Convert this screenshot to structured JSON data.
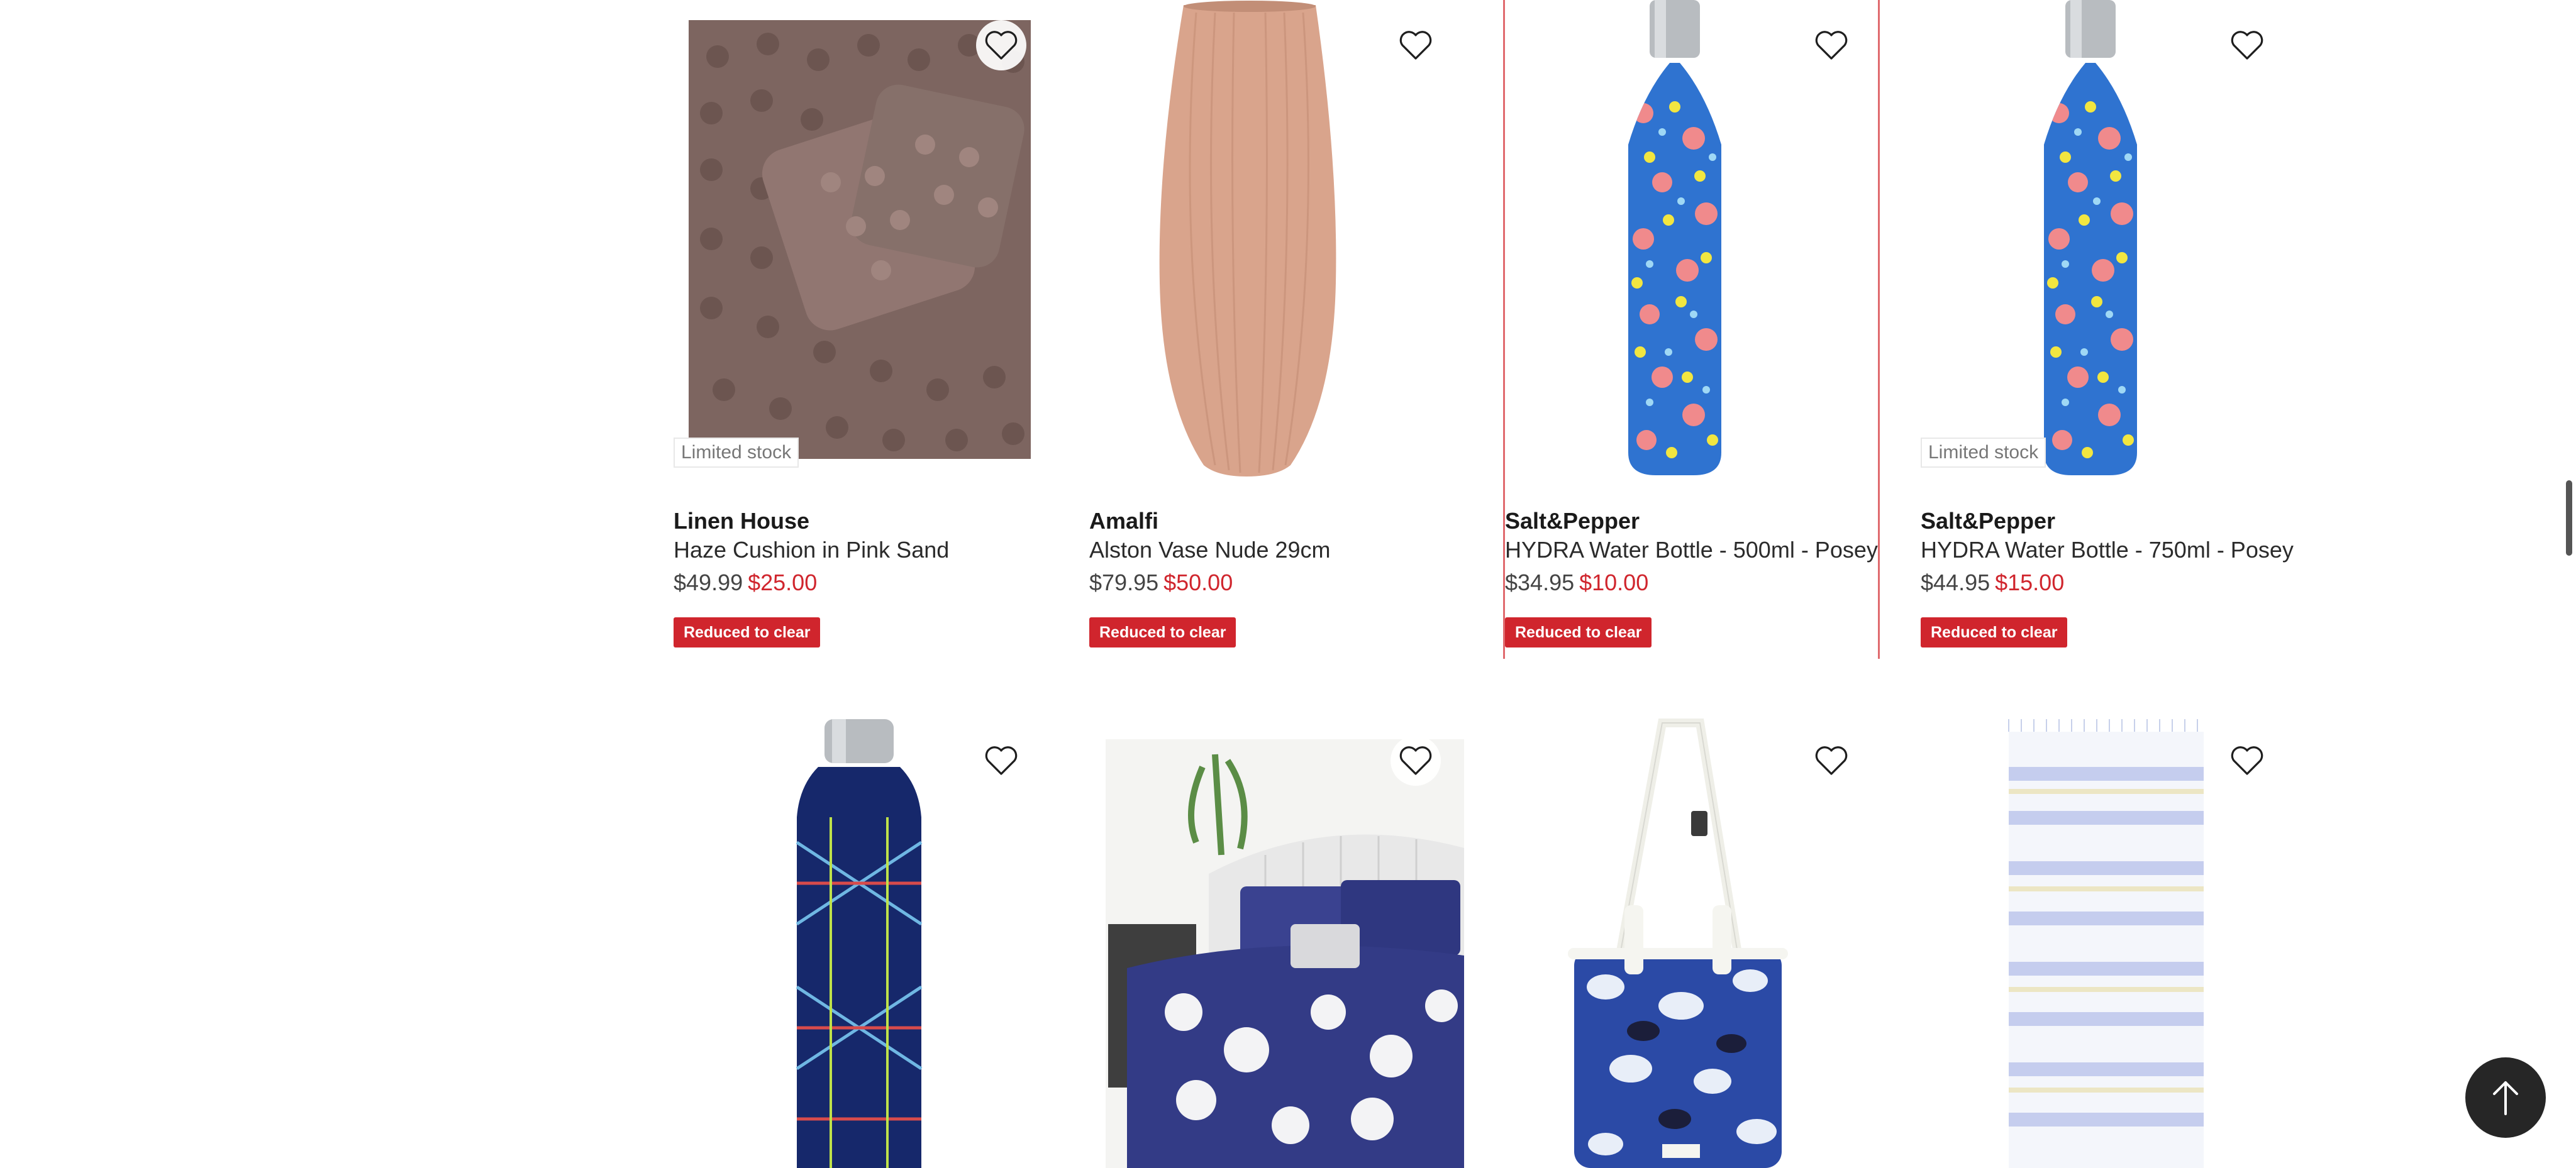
{
  "products": [
    {
      "brand": "Linen House",
      "name": "Haze Cushion in Pink Sand",
      "was": "$49.99",
      "now": "$25.00",
      "badge": "Reduced to clear",
      "limited": "Limited stock"
    },
    {
      "brand": "Amalfi",
      "name": "Alston Vase Nude 29cm",
      "was": "$79.95",
      "now": "$50.00",
      "badge": "Reduced to clear"
    },
    {
      "brand": "Salt&Pepper",
      "name": "HYDRA Water Bottle - 500ml - Posey",
      "was": "$34.95",
      "now": "$10.00",
      "badge": "Reduced to clear"
    },
    {
      "brand": "Salt&Pepper",
      "name": "HYDRA Water Bottle - 750ml - Posey",
      "was": "$44.95",
      "now": "$15.00",
      "badge": "Reduced to clear",
      "limited": "Limited stock"
    }
  ],
  "row2_products": [
    {
      "image": "navy-plaid-bottle"
    },
    {
      "image": "navy-floral-quilt-cover"
    },
    {
      "image": "floral-cooler-bag"
    },
    {
      "image": "striped-beach-towel"
    }
  ],
  "icons": {
    "wishlist": "heart-outline-icon",
    "back_to_top": "arrow-up-icon"
  },
  "colors": {
    "sale_red": "#d0252d",
    "highlight_border": "#e06a6e",
    "back_to_top_bg": "#262626"
  }
}
